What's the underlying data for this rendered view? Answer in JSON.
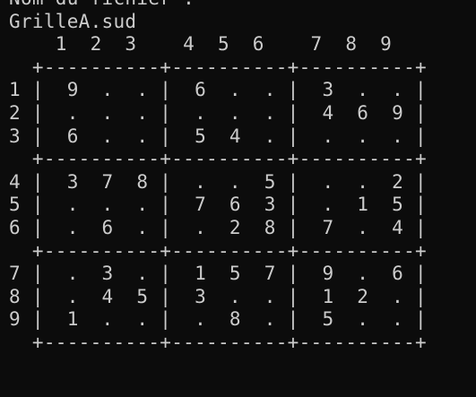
{
  "terminal": {
    "background": "#0c0c0c",
    "foreground": "#cccccc",
    "lines": [
      "Nom du fichier :",
      "GrilleA.sud",
      "    1  2  3    4  5  6    7  8  9",
      "  +----------+----------+----------+",
      "1 |  9  .  . |  6  .  . |  3  .  . |",
      "2 |  .  .  . |  .  .  . |  4  6  9 |",
      "3 |  6  .  . |  5  4  . |  .  .  . |",
      "  +----------+----------+----------+",
      "4 |  3  7  8 |  .  .  5 |  .  .  2 |",
      "5 |  .  .  . |  7  6  3 |  .  1  5 |",
      "6 |  .  6  . |  .  2  8 |  7  .  4 |",
      "  +----------+----------+----------+",
      "7 |  .  3  . |  1  5  7 |  9  .  6 |",
      "8 |  .  4  5 |  3  .  . |  1  2  . |",
      "9 |  1  .  . |  .  8  . |  5  .  . |",
      "  +----------+----------+----------+"
    ]
  }
}
